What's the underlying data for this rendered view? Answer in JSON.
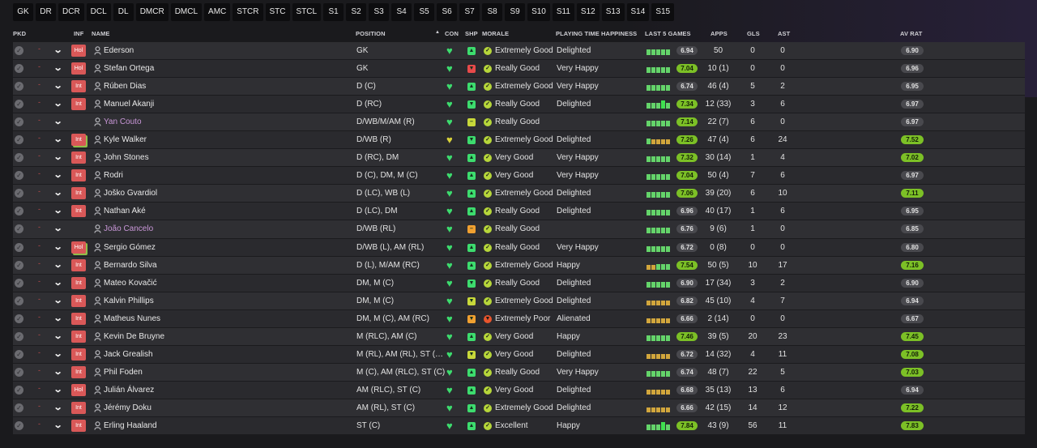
{
  "position_filters": [
    "GK",
    "DR",
    "DCR",
    "DCL",
    "DL",
    "DMCR",
    "DMCL",
    "AMC",
    "STCR",
    "STC",
    "STCL",
    "S1",
    "S2",
    "S3",
    "S4",
    "S5",
    "S6",
    "S7",
    "S8",
    "S9",
    "S10",
    "S11",
    "S12",
    "S13",
    "S14",
    "S15"
  ],
  "columns": {
    "pkd": "PKD",
    "inf": "INF",
    "name": "NAME",
    "position": "POSITION",
    "con": "CON",
    "shp": "SHP",
    "morale": "MORALE",
    "playing_time": "PLAYING TIME HAPPINESS",
    "last5": "LAST 5 GAMES",
    "apps": "APPS",
    "gls": "GLS",
    "ast": "AST",
    "av_rat": "AV RAT",
    "sort_icon": "caret-up-icon"
  },
  "colors": {
    "rating_green": "#7cc026",
    "rating_grey": "#49494e",
    "inf_badge": "#d95858",
    "loan_name": "#c997d8",
    "shp_up": "#3ddc6e",
    "shp_down": "#e84a4a",
    "shp_neutral": "#c8d83a",
    "shp_flat": "#f0a030"
  },
  "players": [
    {
      "inf": "Hol",
      "inf_outline": false,
      "name": "Ederson",
      "loan": false,
      "position": "GK",
      "con": "full",
      "shp": "up",
      "morale": "Extremely Good",
      "morale_level": "good",
      "pth": "Delighted",
      "last5_quality": [
        3,
        3,
        3,
        3,
        3
      ],
      "last5_rating": "6.94",
      "last5_green": false,
      "apps": "50",
      "gls": "0",
      "ast": "0",
      "av_rating": "6.90",
      "av_green": false
    },
    {
      "inf": "Hol",
      "inf_outline": false,
      "name": "Stefan Ortega",
      "loan": false,
      "position": "GK",
      "con": "full",
      "shp": "down",
      "morale": "Really Good",
      "morale_level": "good",
      "pth": "Very Happy",
      "last5_quality": [
        3,
        3,
        3,
        3,
        3
      ],
      "last5_rating": "7.04",
      "last5_green": true,
      "apps": "10 (1)",
      "gls": "0",
      "ast": "0",
      "av_rating": "6.96",
      "av_green": false
    },
    {
      "inf": "Int",
      "inf_outline": false,
      "name": "Rúben Dias",
      "loan": false,
      "position": "D (C)",
      "con": "full",
      "shp": "up",
      "morale": "Extremely Good",
      "morale_level": "good",
      "pth": "Very Happy",
      "last5_quality": [
        3,
        3,
        3,
        3,
        3
      ],
      "last5_rating": "6.74",
      "last5_green": false,
      "apps": "46 (4)",
      "gls": "5",
      "ast": "2",
      "av_rating": "6.95",
      "av_green": false
    },
    {
      "inf": "Int",
      "inf_outline": false,
      "name": "Manuel Akanji",
      "loan": false,
      "position": "D (RC)",
      "con": "full",
      "shp": "down-green",
      "morale": "Really Good",
      "morale_level": "good",
      "pth": "Delighted",
      "last5_quality": [
        3,
        3,
        3,
        4,
        3
      ],
      "last5_rating": "7.34",
      "last5_green": true,
      "apps": "12 (33)",
      "gls": "3",
      "ast": "6",
      "av_rating": "6.97",
      "av_green": false
    },
    {
      "inf": "",
      "inf_outline": false,
      "name": "Yan Couto",
      "loan": true,
      "position": "D/WB/M/AM (R)",
      "con": "full",
      "shp": "flat",
      "morale": "Really Good",
      "morale_level": "good",
      "pth": "",
      "last5_quality": [
        3,
        3,
        3,
        3,
        3
      ],
      "last5_rating": "7.14",
      "last5_green": true,
      "apps": "22 (7)",
      "gls": "6",
      "ast": "0",
      "av_rating": "6.97",
      "av_green": false
    },
    {
      "inf": "Int",
      "inf_outline": true,
      "name": "Kyle Walker",
      "loan": false,
      "position": "D/WB (R)",
      "con": "yellow",
      "shp": "down-green",
      "morale": "Extremely Good",
      "morale_level": "good",
      "pth": "Delighted",
      "last5_quality": [
        3,
        2,
        2,
        2,
        2
      ],
      "last5_rating": "7.26",
      "last5_green": true,
      "apps": "47 (4)",
      "gls": "6",
      "ast": "24",
      "av_rating": "7.52",
      "av_green": true
    },
    {
      "inf": "Int",
      "inf_outline": false,
      "name": "John Stones",
      "loan": false,
      "position": "D (RC), DM",
      "con": "full",
      "shp": "up",
      "morale": "Very Good",
      "morale_level": "good",
      "pth": "Very Happy",
      "last5_quality": [
        3,
        3,
        3,
        3,
        3
      ],
      "last5_rating": "7.32",
      "last5_green": true,
      "apps": "30 (14)",
      "gls": "1",
      "ast": "4",
      "av_rating": "7.02",
      "av_green": true
    },
    {
      "inf": "Int",
      "inf_outline": false,
      "name": "Rodri",
      "loan": false,
      "position": "D (C), DM, M (C)",
      "con": "full",
      "shp": "up",
      "morale": "Very Good",
      "morale_level": "good",
      "pth": "Very Happy",
      "last5_quality": [
        3,
        3,
        3,
        3,
        3
      ],
      "last5_rating": "7.04",
      "last5_green": true,
      "apps": "50 (4)",
      "gls": "7",
      "ast": "6",
      "av_rating": "6.97",
      "av_green": false
    },
    {
      "inf": "Int",
      "inf_outline": false,
      "name": "Joško Gvardiol",
      "loan": false,
      "position": "D (LC), WB (L)",
      "con": "full",
      "shp": "up",
      "morale": "Extremely Good",
      "morale_level": "good",
      "pth": "Delighted",
      "last5_quality": [
        3,
        3,
        3,
        3,
        3
      ],
      "last5_rating": "7.06",
      "last5_green": true,
      "apps": "39 (20)",
      "gls": "6",
      "ast": "10",
      "av_rating": "7.11",
      "av_green": true
    },
    {
      "inf": "Int",
      "inf_outline": false,
      "name": "Nathan Aké",
      "loan": false,
      "position": "D (LC), DM",
      "con": "full",
      "shp": "up",
      "morale": "Really Good",
      "morale_level": "good",
      "pth": "Delighted",
      "last5_quality": [
        3,
        3,
        3,
        3,
        3
      ],
      "last5_rating": "6.96",
      "last5_green": false,
      "apps": "40 (17)",
      "gls": "1",
      "ast": "6",
      "av_rating": "6.95",
      "av_green": false
    },
    {
      "inf": "",
      "inf_outline": false,
      "name": "João Cancelo",
      "loan": true,
      "position": "D/WB (RL)",
      "con": "full",
      "shp": "flat-orange",
      "morale": "Really Good",
      "morale_level": "good",
      "pth": "",
      "last5_quality": [
        3,
        3,
        3,
        3,
        3
      ],
      "last5_rating": "6.76",
      "last5_green": false,
      "apps": "9 (6)",
      "gls": "1",
      "ast": "0",
      "av_rating": "6.85",
      "av_green": false
    },
    {
      "inf": "Hol",
      "inf_outline": true,
      "name": "Sergio Gómez",
      "loan": false,
      "position": "D/WB (L), AM (RL)",
      "con": "full",
      "shp": "up",
      "morale": "Really Good",
      "morale_level": "good",
      "pth": "Very Happy",
      "last5_quality": [
        3,
        3,
        3,
        3,
        3
      ],
      "last5_rating": "6.72",
      "last5_green": false,
      "apps": "0 (8)",
      "gls": "0",
      "ast": "0",
      "av_rating": "6.80",
      "av_green": false
    },
    {
      "inf": "Int",
      "inf_outline": false,
      "name": "Bernardo Silva",
      "loan": false,
      "position": "D (L), M/AM (RC)",
      "con": "full",
      "shp": "up",
      "morale": "Extremely Good",
      "morale_level": "good",
      "pth": "Happy",
      "last5_quality": [
        2,
        2,
        3,
        3,
        3
      ],
      "last5_rating": "7.54",
      "last5_green": true,
      "apps": "50 (5)",
      "gls": "10",
      "ast": "17",
      "av_rating": "7.16",
      "av_green": true
    },
    {
      "inf": "Int",
      "inf_outline": false,
      "name": "Mateo Kovačić",
      "loan": false,
      "position": "DM, M (C)",
      "con": "full",
      "shp": "down-green",
      "morale": "Really Good",
      "morale_level": "good",
      "pth": "Delighted",
      "last5_quality": [
        3,
        3,
        3,
        3,
        3
      ],
      "last5_rating": "6.90",
      "last5_green": false,
      "apps": "17 (34)",
      "gls": "3",
      "ast": "2",
      "av_rating": "6.90",
      "av_green": false
    },
    {
      "inf": "Int",
      "inf_outline": false,
      "name": "Kalvin Phillips",
      "loan": false,
      "position": "DM, M (C)",
      "con": "full",
      "shp": "down-yellow",
      "morale": "Extremely Good",
      "morale_level": "good",
      "pth": "Delighted",
      "last5_quality": [
        2,
        2,
        2,
        2,
        2
      ],
      "last5_rating": "6.82",
      "last5_green": false,
      "apps": "45 (10)",
      "gls": "4",
      "ast": "7",
      "av_rating": "6.94",
      "av_green": false
    },
    {
      "inf": "Int",
      "inf_outline": false,
      "name": "Matheus Nunes",
      "loan": false,
      "position": "DM, M (C), AM (RC)",
      "con": "full",
      "shp": "down-orange",
      "morale": "Extremely Poor",
      "morale_level": "poor",
      "pth": "Alienated",
      "last5_quality": [
        2,
        2,
        2,
        2,
        2
      ],
      "last5_rating": "6.66",
      "last5_green": false,
      "apps": "2 (14)",
      "gls": "0",
      "ast": "0",
      "av_rating": "6.67",
      "av_green": false
    },
    {
      "inf": "Int",
      "inf_outline": false,
      "name": "Kevin De Bruyne",
      "loan": false,
      "position": "M (RLC), AM (C)",
      "con": "full",
      "shp": "up",
      "morale": "Very Good",
      "morale_level": "good",
      "pth": "Happy",
      "last5_quality": [
        3,
        3,
        3,
        3,
        3
      ],
      "last5_rating": "7.46",
      "last5_green": true,
      "apps": "39 (5)",
      "gls": "20",
      "ast": "23",
      "av_rating": "7.45",
      "av_green": true
    },
    {
      "inf": "Int",
      "inf_outline": false,
      "name": "Jack Grealish",
      "loan": false,
      "position": "M (RL), AM (RL), ST (…",
      "con": "full",
      "shp": "down-yellow",
      "morale": "Very Good",
      "morale_level": "good",
      "pth": "Delighted",
      "last5_quality": [
        2,
        2,
        2,
        2,
        2
      ],
      "last5_rating": "6.72",
      "last5_green": false,
      "apps": "14 (32)",
      "gls": "4",
      "ast": "11",
      "av_rating": "7.08",
      "av_green": true
    },
    {
      "inf": "Int",
      "inf_outline": false,
      "name": "Phil Foden",
      "loan": false,
      "position": "M (C), AM (RLC), ST (C)",
      "con": "full",
      "shp": "up",
      "morale": "Really Good",
      "morale_level": "good",
      "pth": "Very Happy",
      "last5_quality": [
        3,
        3,
        3,
        3,
        3
      ],
      "last5_rating": "6.74",
      "last5_green": false,
      "apps": "48 (7)",
      "gls": "22",
      "ast": "5",
      "av_rating": "7.03",
      "av_green": true
    },
    {
      "inf": "Hol",
      "inf_outline": false,
      "name": "Julián Álvarez",
      "loan": false,
      "position": "AM (RLC), ST (C)",
      "con": "full",
      "shp": "up",
      "morale": "Very Good",
      "morale_level": "good",
      "pth": "Delighted",
      "last5_quality": [
        2,
        2,
        2,
        2,
        2
      ],
      "last5_rating": "6.68",
      "last5_green": false,
      "apps": "35 (13)",
      "gls": "13",
      "ast": "6",
      "av_rating": "6.94",
      "av_green": false
    },
    {
      "inf": "Int",
      "inf_outline": false,
      "name": "Jérémy Doku",
      "loan": false,
      "position": "AM (RL), ST (C)",
      "con": "full",
      "shp": "up",
      "morale": "Extremely Good",
      "morale_level": "good",
      "pth": "Delighted",
      "last5_quality": [
        2,
        2,
        2,
        2,
        2
      ],
      "last5_rating": "6.66",
      "last5_green": false,
      "apps": "42 (15)",
      "gls": "14",
      "ast": "12",
      "av_rating": "7.22",
      "av_green": true
    },
    {
      "inf": "Int",
      "inf_outline": false,
      "name": "Erling Haaland",
      "loan": false,
      "position": "ST (C)",
      "con": "full",
      "shp": "up",
      "morale": "Excellent",
      "morale_level": "good",
      "pth": "Happy",
      "last5_quality": [
        3,
        3,
        3,
        4,
        3
      ],
      "last5_rating": "7.84",
      "last5_green": true,
      "apps": "43 (9)",
      "gls": "56",
      "ast": "11",
      "av_rating": "7.83",
      "av_green": true
    }
  ]
}
